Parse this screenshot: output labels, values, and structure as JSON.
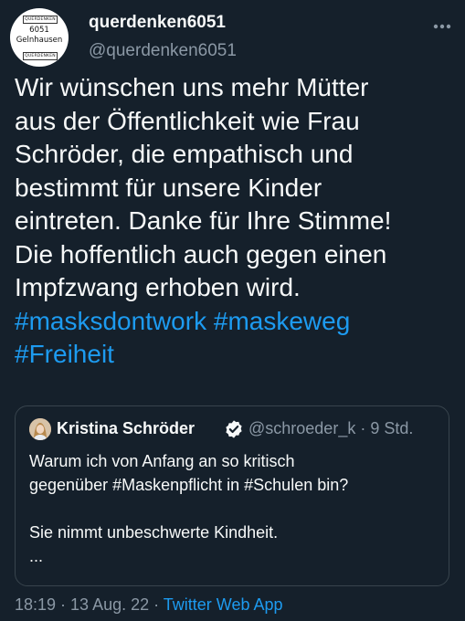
{
  "author": {
    "display_name": "querdenken6051",
    "handle": "@querdenken6051",
    "avatar": {
      "top_text": "QUERDENKEN",
      "middle_line1": "6051",
      "middle_line2": "Gelnhausen",
      "bottom_text": "QUERDENKEN"
    }
  },
  "tweet": {
    "lines": [
      "Wir wünschen uns mehr Mütter",
      "aus der Öffentlichkeit wie Frau",
      "Schröder, die empathisch und",
      "bestimmt für unsere Kinder",
      "eintreten. Danke für Ihre Stimme!",
      "Die hoffentlich auch gegen einen",
      "Impfzwang erhoben wird."
    ],
    "hashtags": [
      "#masksdontwork",
      "#maskeweg",
      "#Freiheit"
    ]
  },
  "quote": {
    "name": "Kristina Schröder",
    "handle_time": "@schroeder_k · 9 Std.",
    "lines": [
      "Warum ich von Anfang an so kritisch",
      "gegenüber #Maskenpflicht in #Schulen bin?",
      "",
      "Sie nimmt unbeschwerte Kindheit.",
      "..."
    ]
  },
  "footer": {
    "time": "18:19 · 13 Aug. 22 · ",
    "source": "Twitter Web App"
  },
  "icons": {
    "more": "more-horizontal-icon",
    "verified": "verified-badge-icon"
  },
  "colors": {
    "background": "#15202b",
    "text": "#f7f9f9",
    "secondary": "#8b98a5",
    "accent": "#1d9bf0",
    "border": "#38444d"
  }
}
